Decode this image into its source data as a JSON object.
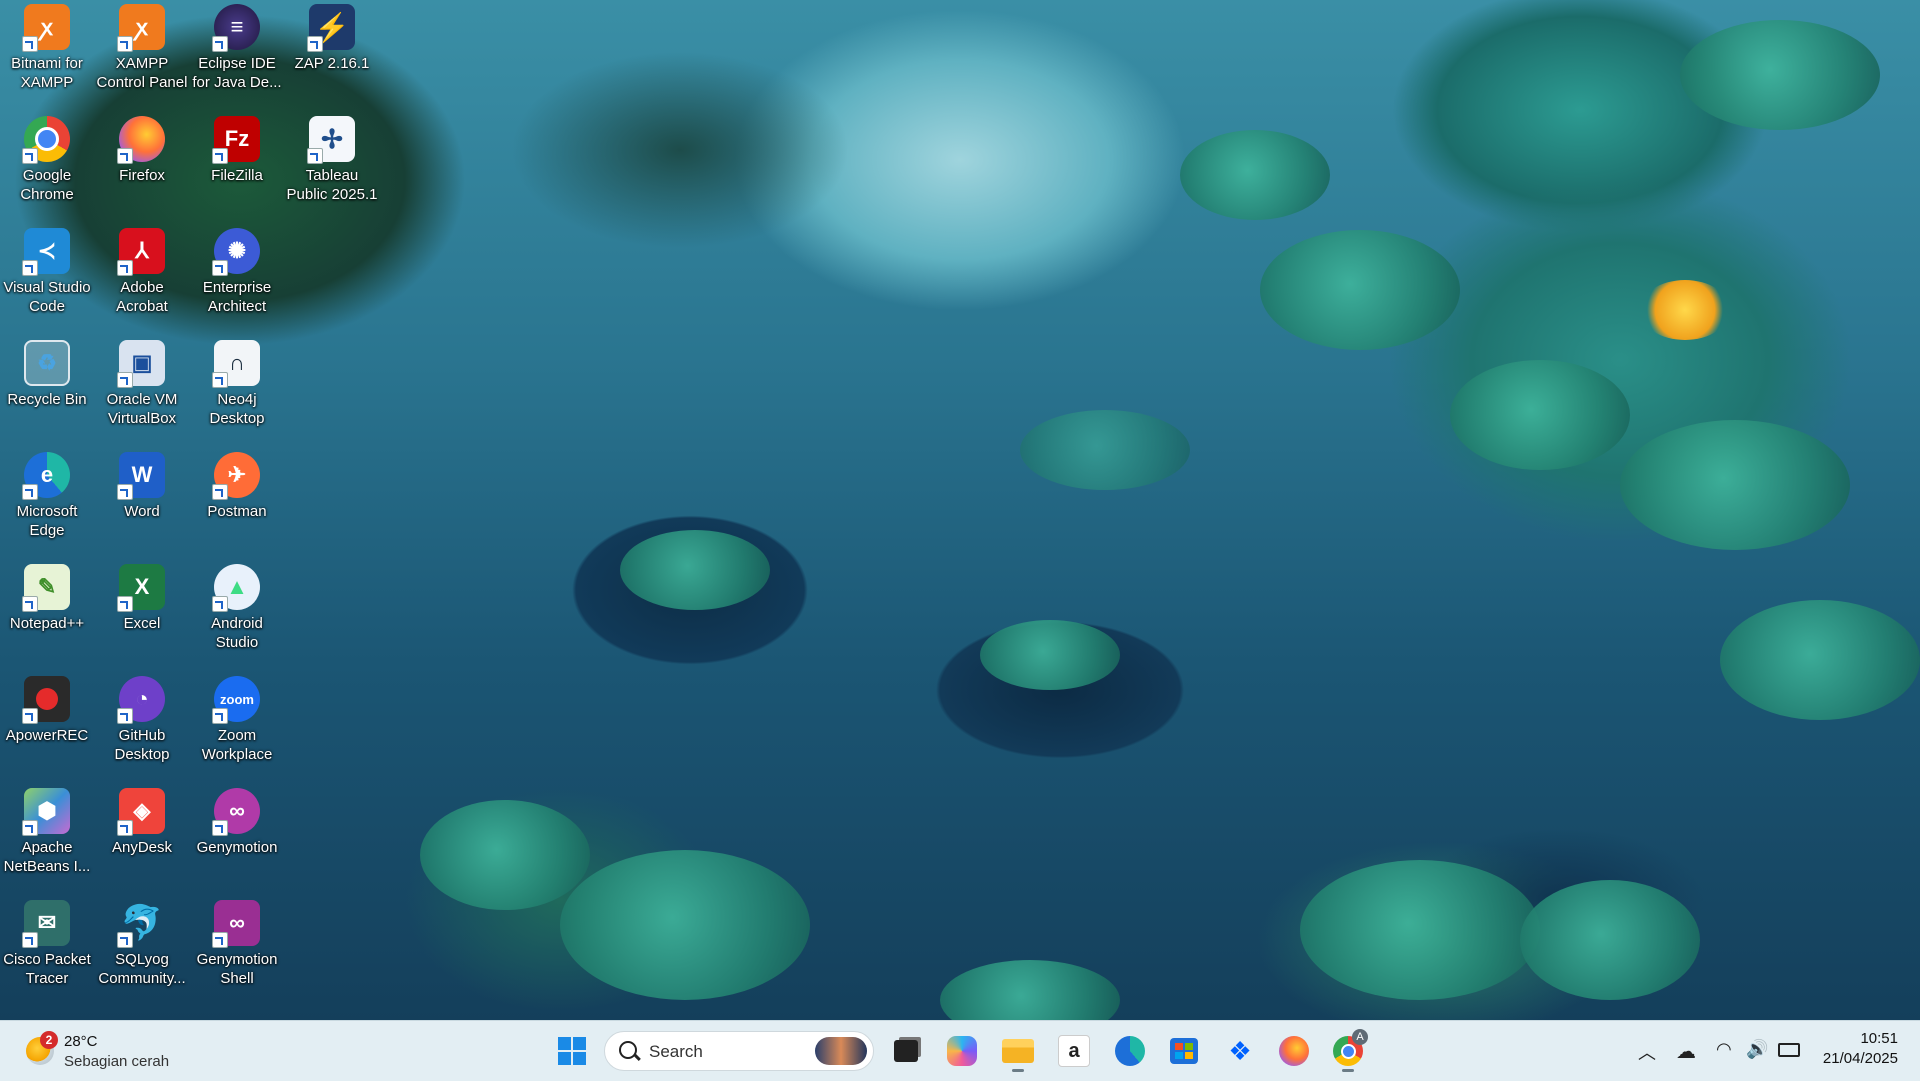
{
  "desktop": {
    "icons": [
      {
        "label": "Bitnami for XAMPP"
      },
      {
        "label": "XAMPP Control Panel"
      },
      {
        "label": "Eclipse IDE for Java De..."
      },
      {
        "label": "ZAP 2.16.1"
      },
      {
        "label": "Google Chrome"
      },
      {
        "label": "Firefox"
      },
      {
        "label": "FileZilla"
      },
      {
        "label": "Tableau Public 2025.1"
      },
      {
        "label": "Visual Studio Code"
      },
      {
        "label": "Adobe Acrobat"
      },
      {
        "label": "Enterprise Architect"
      },
      {
        "label": "Recycle Bin"
      },
      {
        "label": "Oracle VM VirtualBox"
      },
      {
        "label": "Neo4j Desktop"
      },
      {
        "label": "Microsoft Edge"
      },
      {
        "label": "Word"
      },
      {
        "label": "Postman"
      },
      {
        "label": "Notepad++"
      },
      {
        "label": "Excel"
      },
      {
        "label": "Android Studio"
      },
      {
        "label": "ApowerREC"
      },
      {
        "label": "GitHub Desktop"
      },
      {
        "label": "Zoom Workplace"
      },
      {
        "label": "Apache NetBeans I..."
      },
      {
        "label": "AnyDesk"
      },
      {
        "label": "Genymotion"
      },
      {
        "label": "Cisco Packet Tracer"
      },
      {
        "label": "SQLyog Community..."
      },
      {
        "label": "Genymotion Shell"
      }
    ]
  },
  "taskbar": {
    "weather": {
      "badge": "2",
      "temp": "28°C",
      "condition": "Sebagian cerah"
    },
    "search_placeholder": "Search",
    "pinned": [
      "start-icon",
      "task-view-icon",
      "copilot-icon",
      "file-explorer-icon",
      "amazon-icon",
      "edge-icon",
      "store-icon",
      "dropbox-icon",
      "firefox-icon",
      "chrome-icon"
    ],
    "chrome_badge": "A",
    "clock": {
      "time": "10:51",
      "date": "21/04/2025"
    }
  },
  "colors": {
    "taskbar_bg": "#e3eef3",
    "accent": "#1f64c8"
  }
}
